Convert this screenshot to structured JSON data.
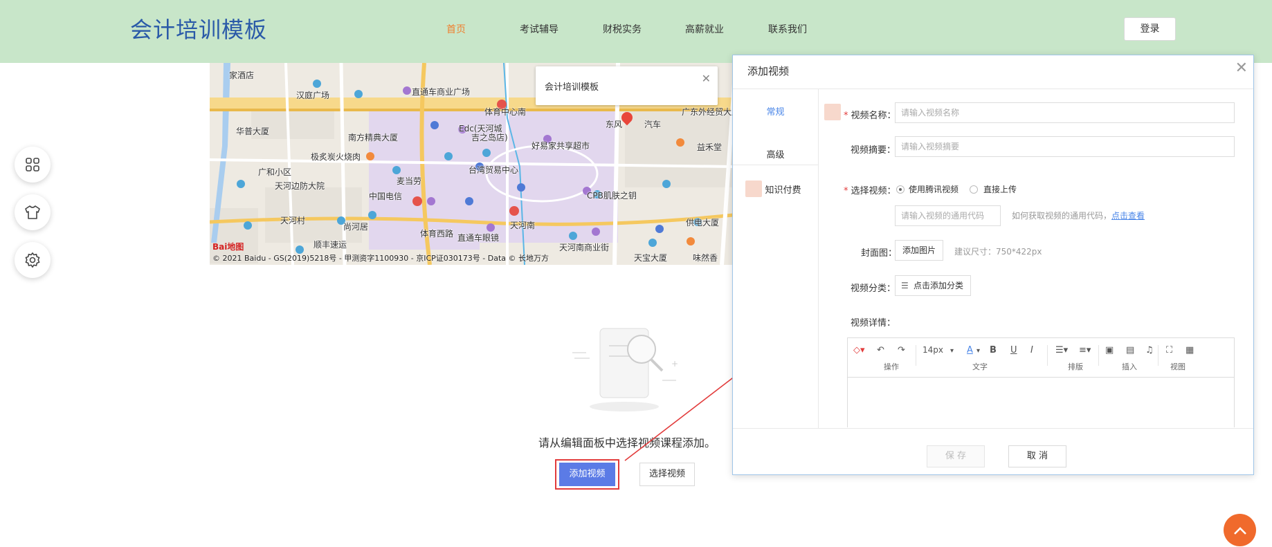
{
  "header": {
    "brand": "会计培训模板",
    "nav": [
      "首页",
      "考试辅导",
      "财税实务",
      "高薪就业",
      "联系我们"
    ],
    "active_nav": "首页",
    "login_label": "登录"
  },
  "side_tools": [
    "apps-grid-icon",
    "shirt-icon",
    "settings-gear-icon"
  ],
  "map": {
    "popup_title": "会计培训模板",
    "labels": [
      "家酒店",
      "汉庭广场",
      "直通车商业广场",
      "体育中心南",
      "广东外经贸大厦",
      "华普大厦",
      "南方精典大厦",
      "Edc(天河城",
      "吉之岛店)",
      "东风",
      "汽车",
      "益禾堂",
      "好易家共享超市",
      "极炙炭火烧肉",
      "广和小区",
      "台湾贸易中心",
      "天河边防大院",
      "麦当劳",
      "中国电信",
      "CPB肌肤之钥",
      "天河村",
      "尚河居",
      "体育西路",
      "直通车眼镜",
      "天河南",
      "供电大厦",
      "顺丰速运",
      "天河南商业街",
      "天宝大厦",
      "味然香"
    ],
    "copyright": "© 2021 Baidu - GS(2019)5218号 - 甲测资字1100930 - 京ICP证030173号 - Data © 长地万方",
    "logo_text": "Bai地图"
  },
  "empty_state": {
    "message": "请从编辑面板中选择视频课程添加。",
    "add_button": "添加视频",
    "choose_button": "选择视频"
  },
  "dialog": {
    "title": "添加视频",
    "tabs": [
      "常规",
      "高级",
      "知识付费"
    ],
    "active_tab": "常规",
    "fields": {
      "name_label": "视频名称：",
      "name_placeholder": "请输入视频名称",
      "summary_label": "视频摘要：",
      "summary_placeholder": "请输入视频摘要",
      "select_label": "选择视频：",
      "option_tencent": "使用腾讯视频",
      "option_upload": "直接上传",
      "code_placeholder": "请输入视频的通用代码",
      "code_hint": "如何获取视频的通用代码，",
      "code_link": "点击查看",
      "cover_label": "封面图：",
      "cover_button": "添加图片",
      "cover_hint": "建议尺寸：750*422px",
      "category_label": "视频分类：",
      "category_button": "点击添加分类",
      "detail_label": "视频详情："
    },
    "editor": {
      "font_size": "14px",
      "groups": [
        "操作",
        "文字",
        "排版",
        "插入",
        "视图"
      ]
    },
    "save_label": "保 存",
    "cancel_label": "取 消"
  },
  "colors": {
    "header_bg": "#c8e6c9",
    "brand": "#2a5aa8",
    "nav_active": "#ef7f2e",
    "primary": "#5b7be6",
    "highlight": "#e23b3b",
    "scroll_top": "#f06a2c"
  }
}
